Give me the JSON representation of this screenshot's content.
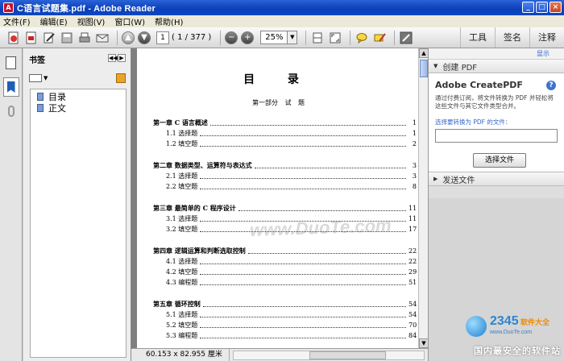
{
  "window": {
    "title": "C语言试题集.pdf - Adobe Reader",
    "app_icon": "A",
    "minimize": "_",
    "maximize": "□",
    "close": "×"
  },
  "menu": [
    "文件(F)",
    "编辑(E)",
    "视图(V)",
    "窗口(W)",
    "帮助(H)"
  ],
  "toolbar": {
    "icons": [
      "create-pdf-icon",
      "convert-icon",
      "edit-icon",
      "save-icon",
      "print-icon",
      "email-icon"
    ],
    "page_current": "1",
    "page_count": "( 1 / 377 )",
    "zoom": "25%",
    "tabs": [
      "工具",
      "签名",
      "注释"
    ]
  },
  "bookmarks": {
    "title": "书签",
    "items": [
      "目录",
      "正文"
    ]
  },
  "document": {
    "title": "目  录",
    "part": "第一部分 试 题",
    "toc": [
      {
        "type": "chapter",
        "label": "第一章  C 语言概述",
        "page": "1"
      },
      {
        "type": "section",
        "label": "1.1  选择题",
        "page": "1"
      },
      {
        "type": "section",
        "label": "1.2  填空题",
        "page": "2"
      },
      {
        "type": "chapter",
        "label": "第二章  数据类型、运算符与表达式",
        "page": "3"
      },
      {
        "type": "section",
        "label": "2.1  选择题",
        "page": "3"
      },
      {
        "type": "section",
        "label": "2.2  填空题",
        "page": "8"
      },
      {
        "type": "chapter",
        "label": "第三章  最简单的 C 程序设计",
        "page": "11"
      },
      {
        "type": "section",
        "label": "3.1  选择题",
        "page": "11"
      },
      {
        "type": "section",
        "label": "3.2  填空题",
        "page": "17"
      },
      {
        "type": "chapter",
        "label": "第四章  逻辑运算和判断选取控制",
        "page": "22"
      },
      {
        "type": "section",
        "label": "4.1  选择题",
        "page": "22"
      },
      {
        "type": "section",
        "label": "4.2  填空题",
        "page": "29"
      },
      {
        "type": "section",
        "label": "4.3  编程题",
        "page": "51"
      },
      {
        "type": "chapter",
        "label": "第五章  循环控制",
        "page": "54"
      },
      {
        "type": "section",
        "label": "5.1  选择题",
        "page": "54"
      },
      {
        "type": "section",
        "label": "5.2  填空题",
        "page": "70"
      },
      {
        "type": "section",
        "label": "5.3  编程题",
        "page": "84"
      }
    ],
    "watermark": "www.DuoTe.com"
  },
  "status": {
    "dimensions": "60.153 x 82.955 厘米"
  },
  "right_panel": {
    "show_link": "显示",
    "create_section": "创建 PDF",
    "heading": "Adobe CreatePDF",
    "description": "通过付费订阅，将文件转换为 PDF 并轻松将这些文件与其它文件类型合并。",
    "select_label": "选择要转换为 PDF 的文件：",
    "choose_button": "选择文件",
    "send_section": "发送文件"
  },
  "branding": {
    "number_main": "2345",
    "number_suffix": "软件",
    "suffix_text": "大全",
    "url": "www.DuoTe.com",
    "slogan": "国内最安全的软件站"
  }
}
